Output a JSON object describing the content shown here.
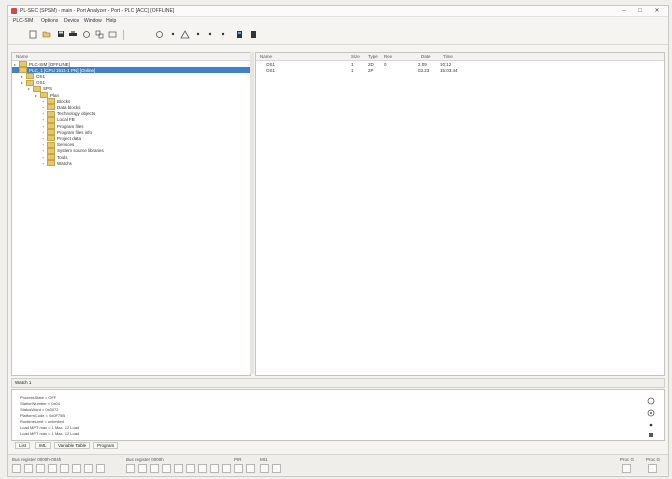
{
  "window": {
    "title": "PL-SEC (SPSM) - main - Port Analyzer - Port - PLC [ACC] [OFFLINE]",
    "minimize": "–",
    "maximize": "□",
    "close": "✕"
  },
  "menu": [
    "PLC-SIM",
    "Options",
    "Device",
    "Window",
    "Help"
  ],
  "toolbar_icons": [
    "new-icon",
    "open-icon",
    "save-icon",
    "print-icon",
    "copy-icon",
    "paste-icon",
    "undo-icon",
    "play-icon",
    "stop-icon",
    "step-icon",
    "monitor-icon",
    "download-icon"
  ],
  "tree": {
    "header": "Name",
    "nodes": [
      {
        "label": "PLC-SIM [OFFLINE]",
        "level": 0,
        "selected": false
      },
      {
        "label": "PLC_1 [CPU 1511-1 PN] [Online]",
        "level": 0,
        "selected": true
      },
      {
        "label": "OS1",
        "level": 1,
        "selected": false
      },
      {
        "label": "OS1",
        "level": 1,
        "selected": false
      },
      {
        "label": "SPS",
        "level": 2,
        "selected": false
      },
      {
        "label": "Plan",
        "level": 3,
        "selected": false
      },
      {
        "label": "Blocks",
        "level": 4,
        "selected": false
      },
      {
        "label": "Data blocks",
        "level": 4,
        "selected": false
      },
      {
        "label": "Technology objects",
        "level": 4,
        "selected": false
      },
      {
        "label": "Local FB",
        "level": 4,
        "selected": false
      },
      {
        "label": "Program files",
        "level": 4,
        "selected": false
      },
      {
        "label": "Program files info",
        "level": 4,
        "selected": false
      },
      {
        "label": "Project data",
        "level": 4,
        "selected": false
      },
      {
        "label": "Services",
        "level": 4,
        "selected": false
      },
      {
        "label": "System source libraries",
        "level": 4,
        "selected": false
      },
      {
        "label": "Tools",
        "level": 4,
        "selected": false
      },
      {
        "label": "Watchs",
        "level": 4,
        "selected": false
      }
    ]
  },
  "list": {
    "columns": [
      "Name",
      "Size",
      "Type",
      "Rev",
      "Date",
      "Time"
    ],
    "rows": [
      {
        "name": "OS1",
        "size": "1",
        "type": "2D",
        "rev": "0",
        "date": "2.09",
        "time": "10:12"
      },
      {
        "name": "OS1",
        "size": "1",
        "type": "2P",
        "rev": "",
        "date": "03.23",
        "time": "15:03:44"
      }
    ]
  },
  "prop_tab": "Watch 1",
  "properties": [
    "ProcessState = OFF",
    "StationNumber = 0x04",
    "StatusWord = 0x0072",
    "PlatformCode = 0x0F75B",
    "RuntimeLimit = unlimited",
    "Load MPT max = 1 Max. 12 Load",
    "Load MPT max = 1 Max. 12 Load"
  ],
  "bottom_tabs": [
    "List",
    "IML",
    "Variable Table",
    "Program"
  ],
  "status": {
    "group1": "Bus register 0000h-004h",
    "group2": "Bus register 0000h",
    "group3": "PIR",
    "group4": "MI1",
    "group5": "Proc G",
    "group6": "Proc G"
  }
}
